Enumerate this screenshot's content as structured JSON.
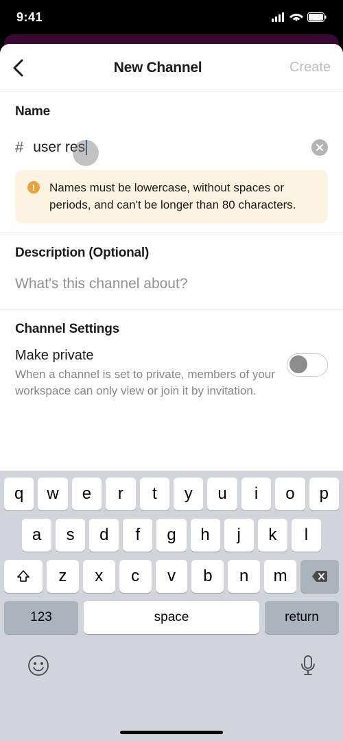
{
  "status": {
    "time": "9:41"
  },
  "nav": {
    "title": "New Channel",
    "action": "Create"
  },
  "name": {
    "label": "Name",
    "prefix": "#",
    "value": "user res"
  },
  "warning": {
    "text": "Names must be lowercase, without spaces or periods, and can't be longer than 80 characters."
  },
  "description": {
    "label": "Description (Optional)",
    "placeholder": "What's this channel about?"
  },
  "settings": {
    "label": "Channel Settings",
    "private_title": "Make private",
    "private_sub": "When a channel is set to private, members of your workspace can only view or join it by invitation."
  },
  "keyboard": {
    "rows": [
      [
        "q",
        "w",
        "e",
        "r",
        "t",
        "y",
        "u",
        "i",
        "o",
        "p"
      ],
      [
        "a",
        "s",
        "d",
        "f",
        "g",
        "h",
        "j",
        "k",
        "l"
      ],
      [
        "z",
        "x",
        "c",
        "v",
        "b",
        "n",
        "m"
      ]
    ],
    "numKey": "123",
    "space": "space",
    "ret": "return"
  }
}
